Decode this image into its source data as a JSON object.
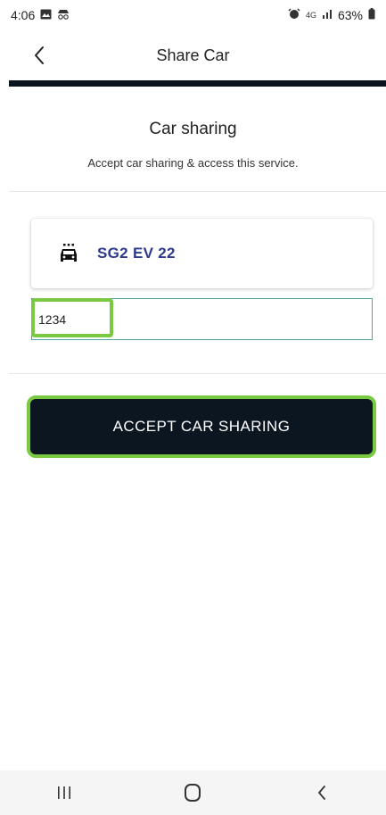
{
  "status_bar": {
    "time": "4:06",
    "left_icons": [
      "gallery-icon",
      "incognito-icon"
    ],
    "right_icons": [
      "alarm-icon",
      "lte-icon",
      "signal-icon"
    ],
    "network": "4G",
    "battery": "63%"
  },
  "header": {
    "title": "Share Car",
    "back_icon": "chevron-left-icon"
  },
  "section": {
    "title": "Car sharing",
    "subtitle": "Accept car sharing & access this service."
  },
  "car": {
    "icon": "car-icon",
    "name": "SG2 EV 22"
  },
  "pin": {
    "value": "1234"
  },
  "accept_button": {
    "label": "ACCEPT CAR SHARING"
  },
  "nav_bar": {
    "recents_icon": "recents-icon",
    "home_icon": "home-icon",
    "back_icon": "back-icon"
  },
  "colors": {
    "accent_green": "#7ac943",
    "dark_navy": "#0b1620",
    "car_name": "#2d3a8c",
    "input_border": "#4aa3a3"
  }
}
